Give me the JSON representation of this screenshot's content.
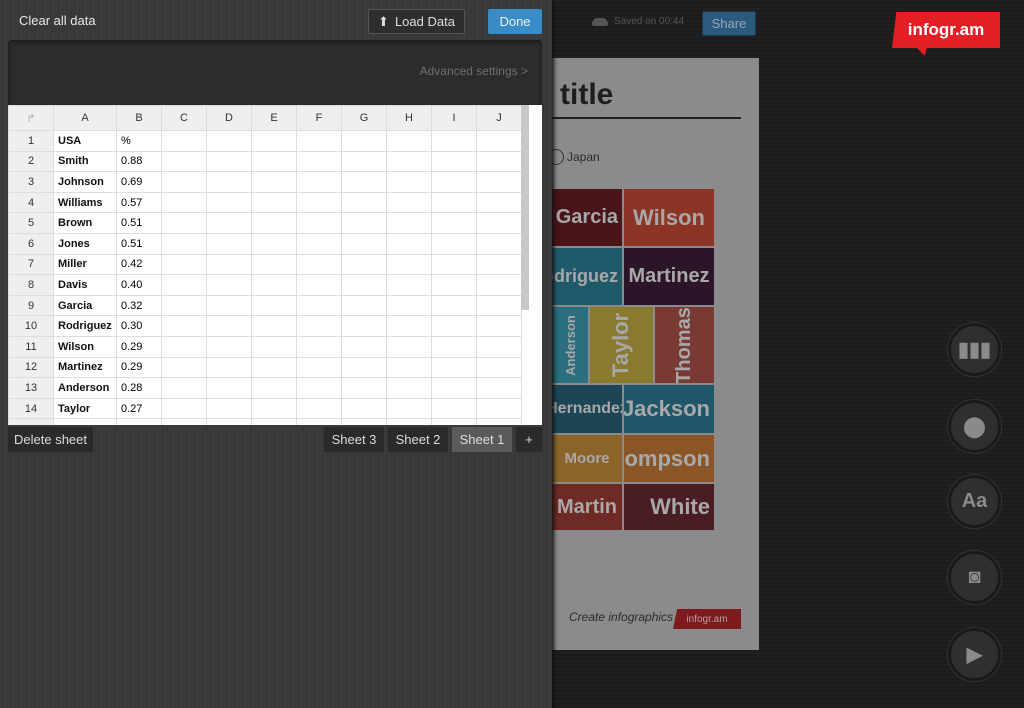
{
  "editor": {
    "clear_label": "Clear all data",
    "load_label": "Load Data",
    "done_label": "Done",
    "advanced_label": "Advanced settings >",
    "columns": [
      "A",
      "B",
      "C",
      "D",
      "E",
      "F",
      "G",
      "H",
      "I",
      "J"
    ],
    "rows": [
      [
        "1",
        "USA",
        "%"
      ],
      [
        "2",
        "Smith",
        "0.88"
      ],
      [
        "3",
        "Johnson",
        "0.69"
      ],
      [
        "4",
        "Williams",
        "0.57"
      ],
      [
        "5",
        "Brown",
        "0.51"
      ],
      [
        "6",
        "Jones",
        "0.51"
      ],
      [
        "7",
        "Miller",
        "0.42"
      ],
      [
        "8",
        "Davis",
        "0.40"
      ],
      [
        "9",
        "Garcia",
        "0.32"
      ],
      [
        "10",
        "Rodriguez",
        "0.30"
      ],
      [
        "11",
        "Wilson",
        "0.29"
      ],
      [
        "12",
        "Martinez",
        "0.29"
      ],
      [
        "13",
        "Anderson",
        "0.28"
      ],
      [
        "14",
        "Taylor",
        "0.27"
      ]
    ],
    "delete_label": "Delete sheet",
    "sheets": [
      "Sheet 3",
      "Sheet 2",
      "Sheet 1"
    ],
    "active_sheet": "Sheet 1",
    "add_label": "+"
  },
  "header": {
    "saved": "Saved on 00:44",
    "share": "Share",
    "logo": "infogr.am"
  },
  "preview": {
    "title": "title",
    "legend": "Japan",
    "footer": "Create infographics",
    "footer_logo": "infogr.am",
    "tiles": [
      {
        "name": "Garcia",
        "color": "#4a1418"
      },
      {
        "name": "Wilson",
        "color": "#8c3426"
      },
      {
        "name": "Rodriguez",
        "color": "#1f5a6a"
      },
      {
        "name": "Martinez",
        "color": "#2c1528"
      },
      {
        "name": "Anderson",
        "color": "#2a6e80"
      },
      {
        "name": "Taylor",
        "color": "#8a7a30"
      },
      {
        "name": "Thomas",
        "color": "#7a3a34"
      },
      {
        "name": "Hernandez",
        "color": "#1c4555"
      },
      {
        "name": "Jackson",
        "color": "#1f5668"
      },
      {
        "name": "Moore",
        "color": "#8a6428"
      },
      {
        "name": "Thompson",
        "color": "#8a5628"
      },
      {
        "name": "Martin",
        "color": "#6e2a24"
      },
      {
        "name": "White",
        "color": "#4a1c24"
      }
    ]
  },
  "tools": [
    "chart-icon",
    "map-pin-icon",
    "text-icon",
    "camera-icon",
    "play-icon"
  ]
}
